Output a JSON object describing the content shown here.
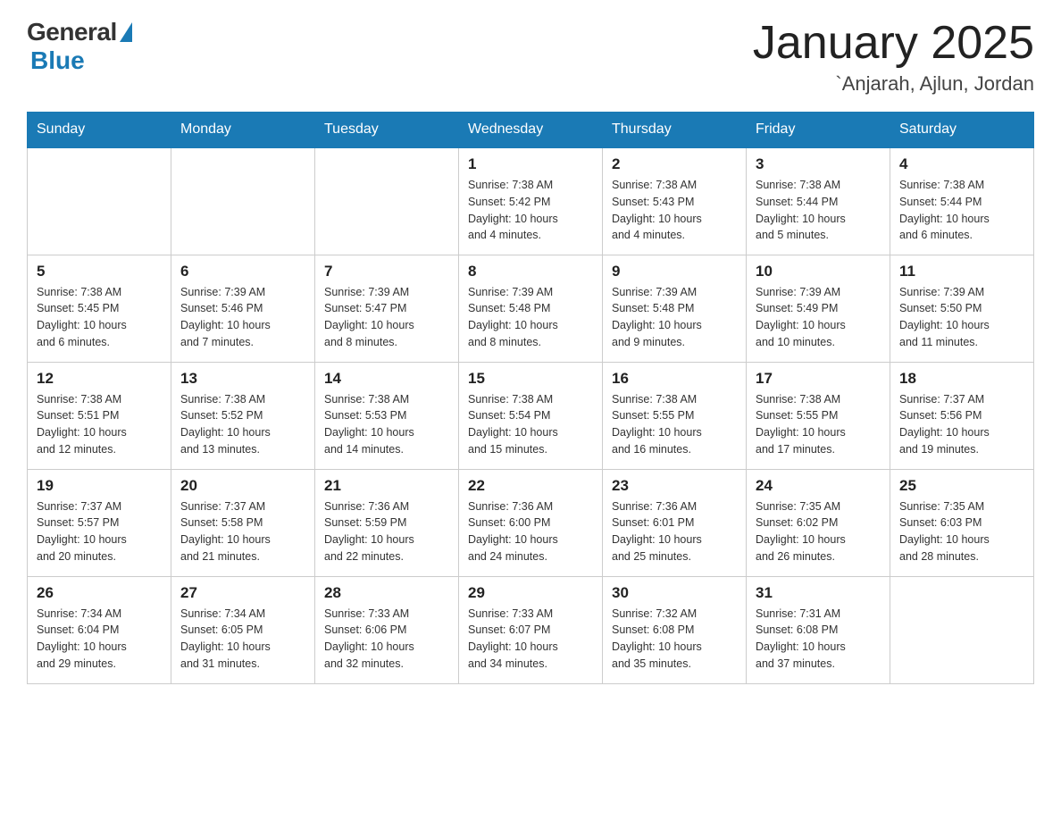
{
  "header": {
    "logo_general": "General",
    "logo_blue": "Blue",
    "title": "January 2025",
    "subtitle": "`Anjarah, Ajlun, Jordan"
  },
  "days_of_week": [
    "Sunday",
    "Monday",
    "Tuesday",
    "Wednesday",
    "Thursday",
    "Friday",
    "Saturday"
  ],
  "weeks": [
    [
      {
        "num": "",
        "info": ""
      },
      {
        "num": "",
        "info": ""
      },
      {
        "num": "",
        "info": ""
      },
      {
        "num": "1",
        "info": "Sunrise: 7:38 AM\nSunset: 5:42 PM\nDaylight: 10 hours\nand 4 minutes."
      },
      {
        "num": "2",
        "info": "Sunrise: 7:38 AM\nSunset: 5:43 PM\nDaylight: 10 hours\nand 4 minutes."
      },
      {
        "num": "3",
        "info": "Sunrise: 7:38 AM\nSunset: 5:44 PM\nDaylight: 10 hours\nand 5 minutes."
      },
      {
        "num": "4",
        "info": "Sunrise: 7:38 AM\nSunset: 5:44 PM\nDaylight: 10 hours\nand 6 minutes."
      }
    ],
    [
      {
        "num": "5",
        "info": "Sunrise: 7:38 AM\nSunset: 5:45 PM\nDaylight: 10 hours\nand 6 minutes."
      },
      {
        "num": "6",
        "info": "Sunrise: 7:39 AM\nSunset: 5:46 PM\nDaylight: 10 hours\nand 7 minutes."
      },
      {
        "num": "7",
        "info": "Sunrise: 7:39 AM\nSunset: 5:47 PM\nDaylight: 10 hours\nand 8 minutes."
      },
      {
        "num": "8",
        "info": "Sunrise: 7:39 AM\nSunset: 5:48 PM\nDaylight: 10 hours\nand 8 minutes."
      },
      {
        "num": "9",
        "info": "Sunrise: 7:39 AM\nSunset: 5:48 PM\nDaylight: 10 hours\nand 9 minutes."
      },
      {
        "num": "10",
        "info": "Sunrise: 7:39 AM\nSunset: 5:49 PM\nDaylight: 10 hours\nand 10 minutes."
      },
      {
        "num": "11",
        "info": "Sunrise: 7:39 AM\nSunset: 5:50 PM\nDaylight: 10 hours\nand 11 minutes."
      }
    ],
    [
      {
        "num": "12",
        "info": "Sunrise: 7:38 AM\nSunset: 5:51 PM\nDaylight: 10 hours\nand 12 minutes."
      },
      {
        "num": "13",
        "info": "Sunrise: 7:38 AM\nSunset: 5:52 PM\nDaylight: 10 hours\nand 13 minutes."
      },
      {
        "num": "14",
        "info": "Sunrise: 7:38 AM\nSunset: 5:53 PM\nDaylight: 10 hours\nand 14 minutes."
      },
      {
        "num": "15",
        "info": "Sunrise: 7:38 AM\nSunset: 5:54 PM\nDaylight: 10 hours\nand 15 minutes."
      },
      {
        "num": "16",
        "info": "Sunrise: 7:38 AM\nSunset: 5:55 PM\nDaylight: 10 hours\nand 16 minutes."
      },
      {
        "num": "17",
        "info": "Sunrise: 7:38 AM\nSunset: 5:55 PM\nDaylight: 10 hours\nand 17 minutes."
      },
      {
        "num": "18",
        "info": "Sunrise: 7:37 AM\nSunset: 5:56 PM\nDaylight: 10 hours\nand 19 minutes."
      }
    ],
    [
      {
        "num": "19",
        "info": "Sunrise: 7:37 AM\nSunset: 5:57 PM\nDaylight: 10 hours\nand 20 minutes."
      },
      {
        "num": "20",
        "info": "Sunrise: 7:37 AM\nSunset: 5:58 PM\nDaylight: 10 hours\nand 21 minutes."
      },
      {
        "num": "21",
        "info": "Sunrise: 7:36 AM\nSunset: 5:59 PM\nDaylight: 10 hours\nand 22 minutes."
      },
      {
        "num": "22",
        "info": "Sunrise: 7:36 AM\nSunset: 6:00 PM\nDaylight: 10 hours\nand 24 minutes."
      },
      {
        "num": "23",
        "info": "Sunrise: 7:36 AM\nSunset: 6:01 PM\nDaylight: 10 hours\nand 25 minutes."
      },
      {
        "num": "24",
        "info": "Sunrise: 7:35 AM\nSunset: 6:02 PM\nDaylight: 10 hours\nand 26 minutes."
      },
      {
        "num": "25",
        "info": "Sunrise: 7:35 AM\nSunset: 6:03 PM\nDaylight: 10 hours\nand 28 minutes."
      }
    ],
    [
      {
        "num": "26",
        "info": "Sunrise: 7:34 AM\nSunset: 6:04 PM\nDaylight: 10 hours\nand 29 minutes."
      },
      {
        "num": "27",
        "info": "Sunrise: 7:34 AM\nSunset: 6:05 PM\nDaylight: 10 hours\nand 31 minutes."
      },
      {
        "num": "28",
        "info": "Sunrise: 7:33 AM\nSunset: 6:06 PM\nDaylight: 10 hours\nand 32 minutes."
      },
      {
        "num": "29",
        "info": "Sunrise: 7:33 AM\nSunset: 6:07 PM\nDaylight: 10 hours\nand 34 minutes."
      },
      {
        "num": "30",
        "info": "Sunrise: 7:32 AM\nSunset: 6:08 PM\nDaylight: 10 hours\nand 35 minutes."
      },
      {
        "num": "31",
        "info": "Sunrise: 7:31 AM\nSunset: 6:08 PM\nDaylight: 10 hours\nand 37 minutes."
      },
      {
        "num": "",
        "info": ""
      }
    ]
  ]
}
